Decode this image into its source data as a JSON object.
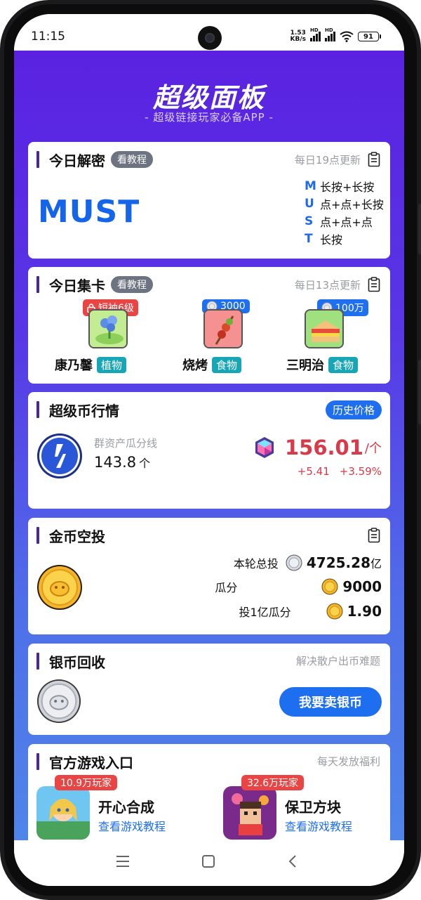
{
  "status": {
    "time": "11:15",
    "speed": "1.53",
    "speed_unit": "KB/s",
    "hd1": "HD",
    "hd2": "HD",
    "battery": "91"
  },
  "header": {
    "title": "超级面板",
    "subtitle": "- 超级链接玩家必备APP -"
  },
  "decode": {
    "title": "今日解密",
    "tutorial": "看教程",
    "update": "每日19点更新",
    "word": "MUST",
    "rows": [
      {
        "letter": "M",
        "action": "长按+长按"
      },
      {
        "letter": "U",
        "action": "点+点+长按"
      },
      {
        "letter": "S",
        "action": "点+点+点"
      },
      {
        "letter": "T",
        "action": "长按"
      }
    ]
  },
  "collect": {
    "title": "今日集卡",
    "tutorial": "看教程",
    "update": "每日13点更新",
    "items": [
      {
        "badge": "短袖6级",
        "name": "康乃馨",
        "tag": "植物"
      },
      {
        "badge": "3000",
        "name": "烧烤",
        "tag": "食物"
      },
      {
        "badge": "100万",
        "name": "三明治",
        "tag": "食物"
      }
    ]
  },
  "market": {
    "title": "超级币行情",
    "history": "历史价格",
    "label": "群资产瓜分线",
    "amount": "143.8",
    "amount_unit": "个",
    "price": "156.01",
    "price_unit": "/个",
    "change_abs": "+5.41",
    "change_pct": "+3.59%"
  },
  "airdrop": {
    "title": "金币空投",
    "total_label": "本轮总投",
    "total_value": "4725.28",
    "total_unit": "亿",
    "share_label": "瓜分",
    "share_value": "9000",
    "per_label": "投1亿瓜分",
    "per_value": "1.90"
  },
  "recycle": {
    "title": "银币回收",
    "desc": "解决散户出币难题",
    "button": "我要卖银币"
  },
  "games": {
    "title": "官方游戏入口",
    "desc": "每天发放福利",
    "items": [
      {
        "players": "10.9万玩家",
        "name": "开心合成",
        "link": "查看游戏教程"
      },
      {
        "players": "32.6万玩家",
        "name": "保卫方块",
        "link": "查看游戏教程"
      }
    ]
  },
  "icons": [
    "menu-icon",
    "home-icon",
    "back-icon",
    "clipboard-icon",
    "lock-icon",
    "silver-coin-icon",
    "gold-coin-icon",
    "gem-icon"
  ],
  "colors": {
    "brand_purple": "#5a22e0",
    "accent_blue": "#1e6ff0",
    "price_red": "#d83a4a",
    "tag_teal": "#17a6b6"
  }
}
